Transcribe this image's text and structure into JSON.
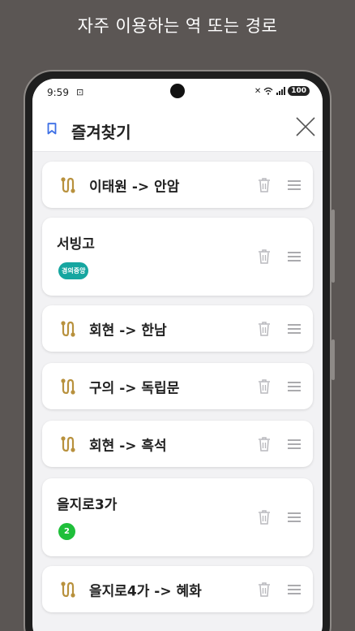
{
  "caption": "자주 이용하는 역 또는 경로",
  "status_bar": {
    "time": "9:59",
    "battery": "100"
  },
  "header": {
    "title": "즐겨찾기"
  },
  "colors": {
    "route_icon": "#b8913d",
    "gyeongui_line": "#16a6a0",
    "line_2": "#1fbf3a",
    "bookmark": "#3d6fe5"
  },
  "favorites": [
    {
      "type": "route",
      "label": "이태원 -> 안암"
    },
    {
      "type": "station",
      "label": "서빙고",
      "line_badge": "경의중앙"
    },
    {
      "type": "route",
      "label": "회현 -> 한남"
    },
    {
      "type": "route",
      "label": "구의 -> 독립문"
    },
    {
      "type": "route",
      "label": "회현 -> 흑석"
    },
    {
      "type": "station",
      "label": "을지로3가",
      "line_badge": "2"
    },
    {
      "type": "route",
      "label": "을지로4가 -> 혜화"
    }
  ]
}
